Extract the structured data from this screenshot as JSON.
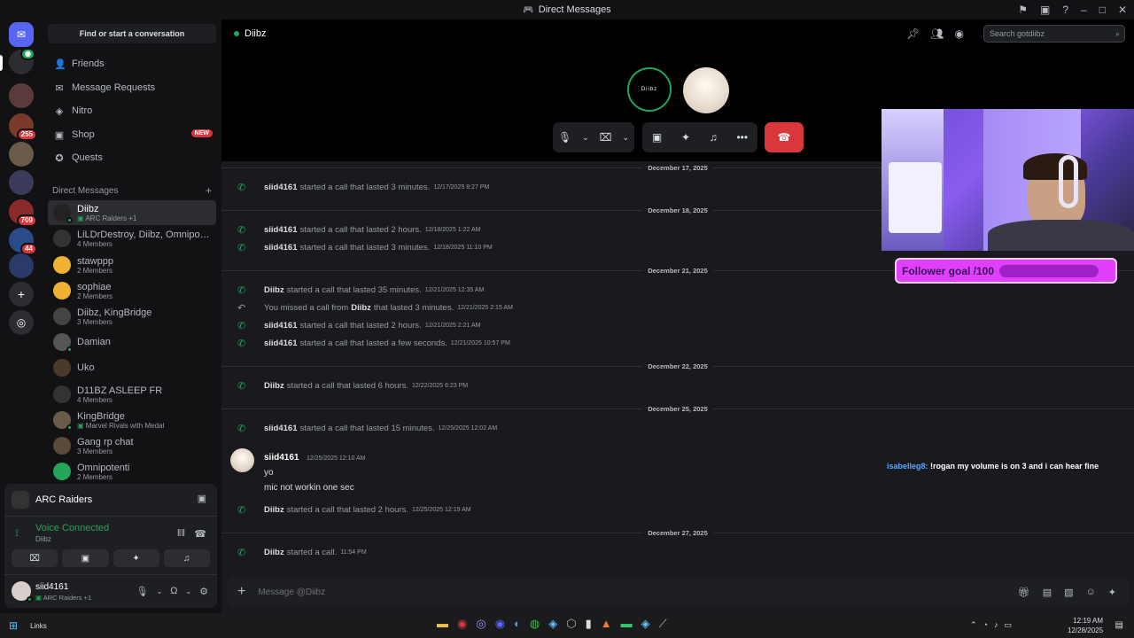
{
  "window": {
    "title": "Direct Messages"
  },
  "sidebar": {
    "find_label": "Find or start a conversation",
    "nav": [
      {
        "label": "Friends",
        "icon": "friends-icon"
      },
      {
        "label": "Message Requests",
        "icon": "mail-icon"
      },
      {
        "label": "Nitro",
        "icon": "nitro-icon"
      },
      {
        "label": "Shop",
        "icon": "shop-icon",
        "badge": "NEW"
      },
      {
        "label": "Quests",
        "icon": "quests-icon"
      }
    ],
    "dm_header": "Direct Messages",
    "dms": [
      {
        "name": "Diibz",
        "sub": "ARC Raiders +1",
        "sub_game": true,
        "active": true
      },
      {
        "name": "LiLDrDestroy, Diibz, Omnipot...",
        "sub": "4 Members"
      },
      {
        "name": "stawppp",
        "sub": "2 Members"
      },
      {
        "name": "sophiae",
        "sub": "2 Members"
      },
      {
        "name": "Diibz, KingBridge",
        "sub": "3 Members"
      },
      {
        "name": "Damian",
        "sub": ""
      },
      {
        "name": "Uko",
        "sub": ""
      },
      {
        "name": "D11BZ ASLEEP FR",
        "sub": "4 Members"
      },
      {
        "name": "KingBridge",
        "sub": "Marvel Rivals with Medal",
        "sub_game": true
      },
      {
        "name": "Gang rp chat",
        "sub": "3 Members"
      },
      {
        "name": "Omnipotenti",
        "sub": "2 Members"
      }
    ]
  },
  "servers": {
    "badges": [
      "255",
      "709",
      "44"
    ]
  },
  "panel": {
    "activity": "ARC Raiders",
    "voice_status": "Voice Connected",
    "voice_channel": "Diibz",
    "user_name": "siid4161",
    "user_sub": "ARC Raiders +1"
  },
  "call": {
    "header_name": "Diibz",
    "avatar_text": "Diibz",
    "search_placeholder": "Search gotdiibz"
  },
  "messages": {
    "dates": [
      "December 17, 2025",
      "December 18, 2025",
      "December 21, 2025",
      "December 22, 2025",
      "December 25, 2025",
      "December 27, 2025"
    ],
    "calls": [
      {
        "user": "siid4161",
        "text": "started a call that lasted 3 minutes.",
        "ts": "12/17/2025 8:27 PM"
      },
      {
        "user": "siid4161",
        "text": "started a call that lasted 2 hours.",
        "ts": "12/18/2025 1:22 AM"
      },
      {
        "user": "siid4161",
        "text": "started a call that lasted 3 minutes.",
        "ts": "12/18/2025 11:10 PM"
      },
      {
        "user": "Diibz",
        "text": "started a call that lasted 35 minutes.",
        "ts": "12/21/2025 12:35 AM"
      },
      {
        "user": "",
        "pre": "You missed a call from",
        "mid": "Diibz",
        "text": "that lasted 3 minutes.",
        "ts": "12/21/2025 2:15 AM",
        "missed": true
      },
      {
        "user": "siid4161",
        "text": "started a call that lasted 2 hours.",
        "ts": "12/21/2025 2:21 AM"
      },
      {
        "user": "siid4161",
        "text": "started a call that lasted a few seconds.",
        "ts": "12/21/2025 10:57 PM"
      },
      {
        "user": "Diibz",
        "text": "started a call that lasted 6 hours.",
        "ts": "12/22/2025 6:23 PM"
      },
      {
        "user": "siid4161",
        "text": "started a call that lasted 15 minutes.",
        "ts": "12/25/2025 12:02 AM"
      },
      {
        "user": "Diibz",
        "text": "started a call that lasted 2 hours.",
        "ts": "12/25/2025 12:19 AM"
      },
      {
        "user": "Diibz",
        "text": "started a call.",
        "ts": "11:54 PM"
      }
    ],
    "chat": {
      "user": "siid4161",
      "ts": "12/25/2025 12:10 AM",
      "lines": [
        "yo",
        "mic not workin one sec"
      ]
    },
    "input_placeholder": "Message @Diibz"
  },
  "overlay": {
    "goal": "Follower goal /100",
    "chat_user": "isabelleg8:",
    "chat_text": "!rogan my volume is on 3 and i can hear fine"
  },
  "taskbar": {
    "links": "Links",
    "time": "12:19 AM",
    "date": "12/28/2025"
  },
  "colors": {
    "accent": "#5865f2",
    "green": "#23a55a",
    "red": "#da373c",
    "goal": "#e040fb"
  }
}
